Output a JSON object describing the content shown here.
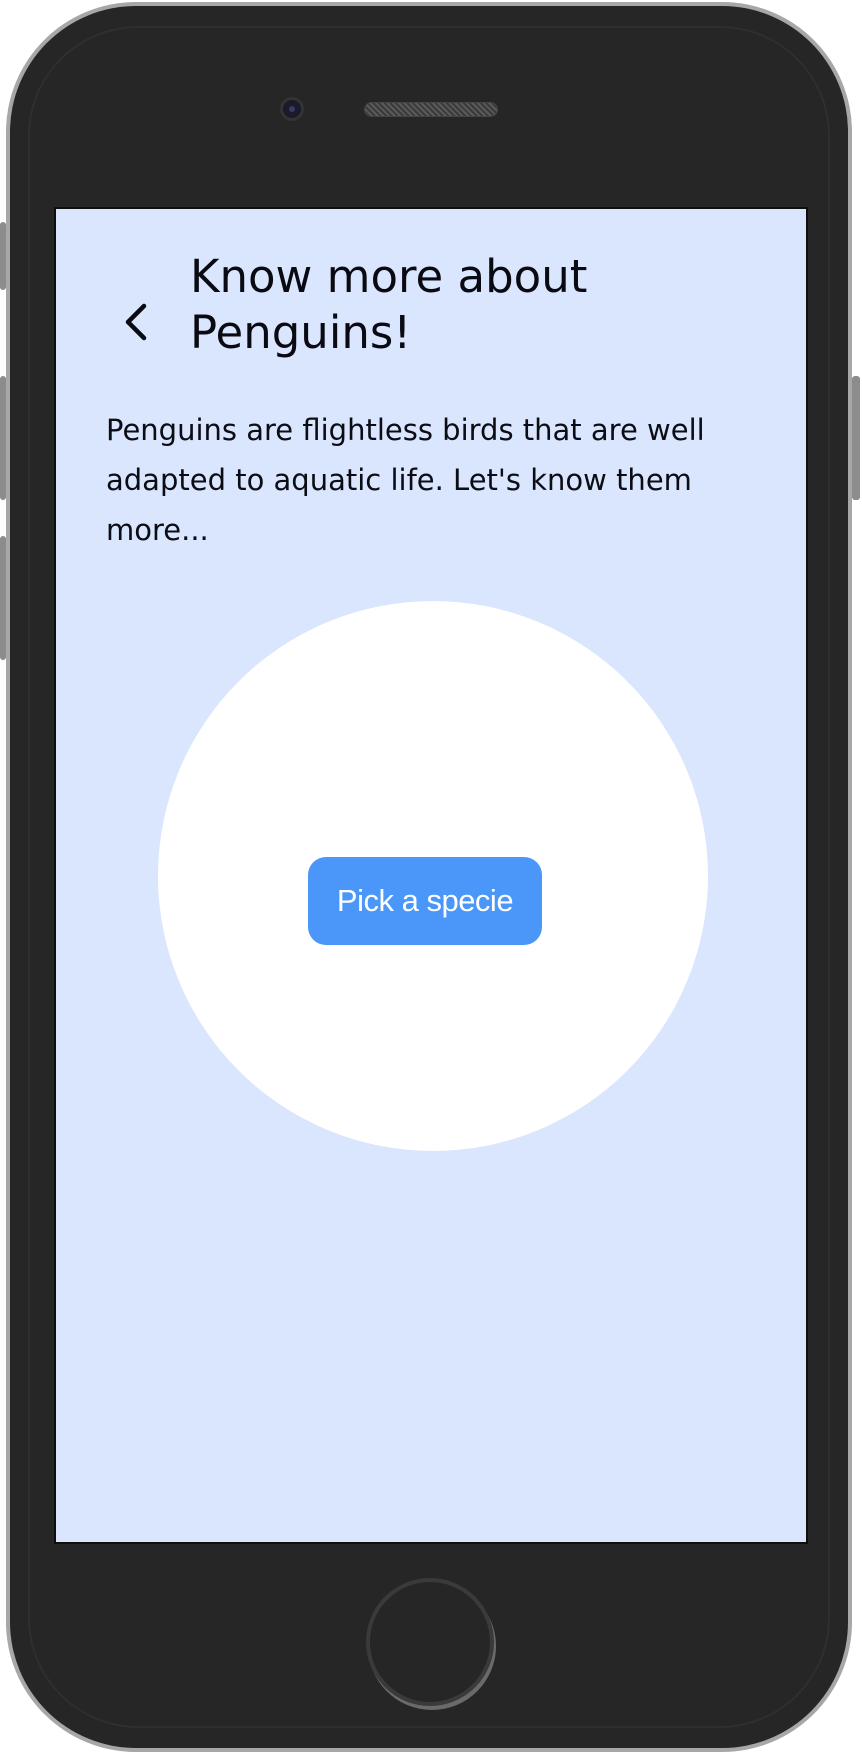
{
  "header": {
    "title": "Know more about Penguins!",
    "back_icon": "chevron-left-icon"
  },
  "main": {
    "description": "Penguins are flightless birds that are well adapted to aquatic life. Let's know them more...",
    "pick_button_label": "Pick a specie"
  },
  "colors": {
    "screen_background": "#d9e6fd",
    "circle_background": "#ffffff",
    "button_background": "#4a97f9",
    "button_text": "#ffffff",
    "text": "#0a0a12",
    "device_frame": "#262626"
  }
}
